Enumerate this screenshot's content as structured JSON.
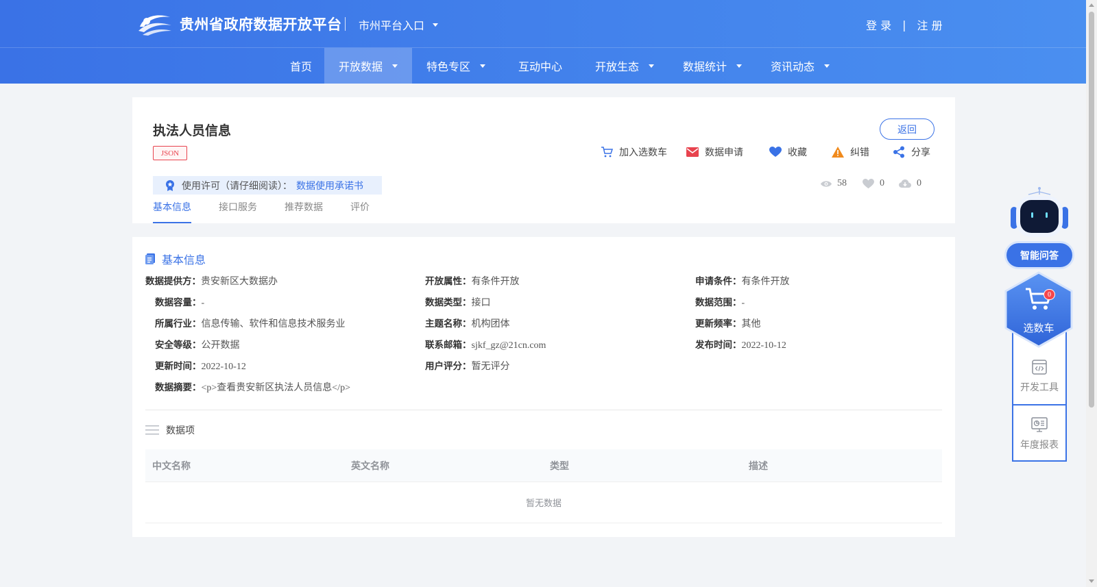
{
  "header": {
    "site_title": "贵州省政府数据开放平台",
    "city_entry": "市州平台入口",
    "login": "登 录",
    "separator": "|",
    "register": "注 册"
  },
  "nav": {
    "items": [
      {
        "label": "首页",
        "active": false,
        "dropdown": false
      },
      {
        "label": "开放数据",
        "active": true,
        "dropdown": true
      },
      {
        "label": "特色专区",
        "active": false,
        "dropdown": true
      },
      {
        "label": "互动中心",
        "active": false,
        "dropdown": false
      },
      {
        "label": "开放生态",
        "active": false,
        "dropdown": true
      },
      {
        "label": "数据统计",
        "active": false,
        "dropdown": true
      },
      {
        "label": "资讯动态",
        "active": false,
        "dropdown": true
      }
    ]
  },
  "dataset": {
    "title": "执法人员信息",
    "format_badge": "JSON",
    "back_label": "返回",
    "actions": {
      "add_cart": "加入选数车",
      "apply": "数据申请",
      "favorite": "收藏",
      "report_error": "纠错",
      "share": "分享"
    },
    "license": {
      "label": "使用许可（请仔细阅读）：",
      "link": "数据使用承诺书"
    },
    "stats": {
      "views": "58",
      "likes": "0",
      "downloads": "0"
    },
    "tabs": [
      "基本信息",
      "接口服务",
      "推荐数据",
      "评价"
    ]
  },
  "basic_info": {
    "section_title": "基本信息",
    "fields": [
      {
        "label": "数据提供方：",
        "value": "贵安新区大数据办"
      },
      {
        "label": "开放属性：",
        "value": "有条件开放"
      },
      {
        "label": "申请条件：",
        "value": "有条件开放"
      },
      {
        "label": "数据容量：",
        "value": "-"
      },
      {
        "label": "数据类型：",
        "value": "接口"
      },
      {
        "label": "数据范围：",
        "value": "-"
      },
      {
        "label": "所属行业：",
        "value": "信息传输、软件和信息技术服务业"
      },
      {
        "label": "主题名称：",
        "value": "机构团体"
      },
      {
        "label": "更新频率：",
        "value": "其他"
      },
      {
        "label": "安全等级：",
        "value": "公开数据"
      },
      {
        "label": "联系邮箱：",
        "value": "sjkf_gz@21cn.com"
      },
      {
        "label": "发布时间：",
        "value": "2022-10-12"
      },
      {
        "label": "更新时间：",
        "value": "2022-10-12"
      },
      {
        "label": "用户评分：",
        "value": "暂无评分"
      },
      {
        "label": "数据摘要：",
        "value": "<p>查看贵安新区执法人员信息</p>"
      }
    ]
  },
  "data_items": {
    "section_title": "数据项",
    "columns": [
      "中文名称",
      "英文名称",
      "类型",
      "描述"
    ],
    "empty_text": "暂无数据"
  },
  "float_panel": {
    "ai_label": "智能问答",
    "cart_label": "选数车",
    "cart_count": "0",
    "dev_tools": "开发工具",
    "annual_report": "年度报表"
  },
  "colors": {
    "primary": "#3a72e6",
    "header_gradient_end": "#4a8ff0",
    "danger": "#e8434e",
    "warning": "#f08a1c"
  }
}
